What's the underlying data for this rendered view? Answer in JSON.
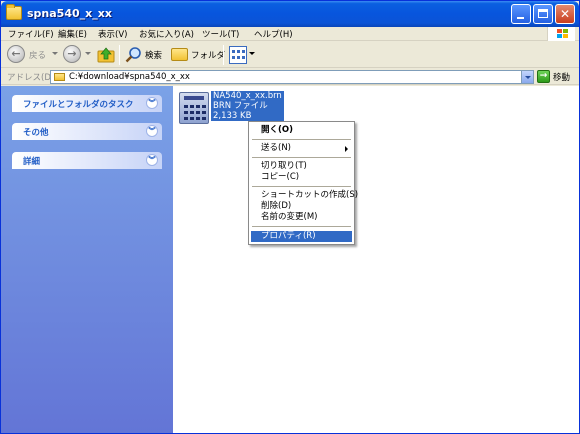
{
  "window": {
    "title": "spna540_x_xx"
  },
  "menubar": [
    "ファイル(F)",
    "編集(E)",
    "表示(V)",
    "お気に入り(A)",
    "ツール(T)",
    "ヘルプ(H)"
  ],
  "toolbar": {
    "back_label": "戻る",
    "search_label": "検索",
    "folders_label": "フォルダ"
  },
  "address": {
    "label": "アドレス(D)",
    "value": "C:¥download¥spna540_x_xx",
    "go_label": "移動"
  },
  "left_panel": {
    "sections": [
      {
        "title": "ファイルとフォルダのタスク"
      },
      {
        "title": "その他"
      },
      {
        "title": "詳細"
      }
    ]
  },
  "file": {
    "name": "NA540_x_xx.brn",
    "type": "BRN ファイル",
    "size": "2,133 KB"
  },
  "context_menu": {
    "items": [
      {
        "label": "開く(O)",
        "bold": true
      },
      {
        "label": "送る(N)",
        "submenu": true
      },
      {
        "label": "切り取り(T)"
      },
      {
        "label": "コピー(C)"
      },
      {
        "label": "ショートカットの作成(S)"
      },
      {
        "label": "削除(D)"
      },
      {
        "label": "名前の変更(M)"
      },
      {
        "label": "プロパティ(R)",
        "selected": true
      }
    ]
  },
  "colors": {
    "titlebar": "#0a5fe0",
    "selection": "#316ac5",
    "task_pane": "#7ba2e7"
  }
}
